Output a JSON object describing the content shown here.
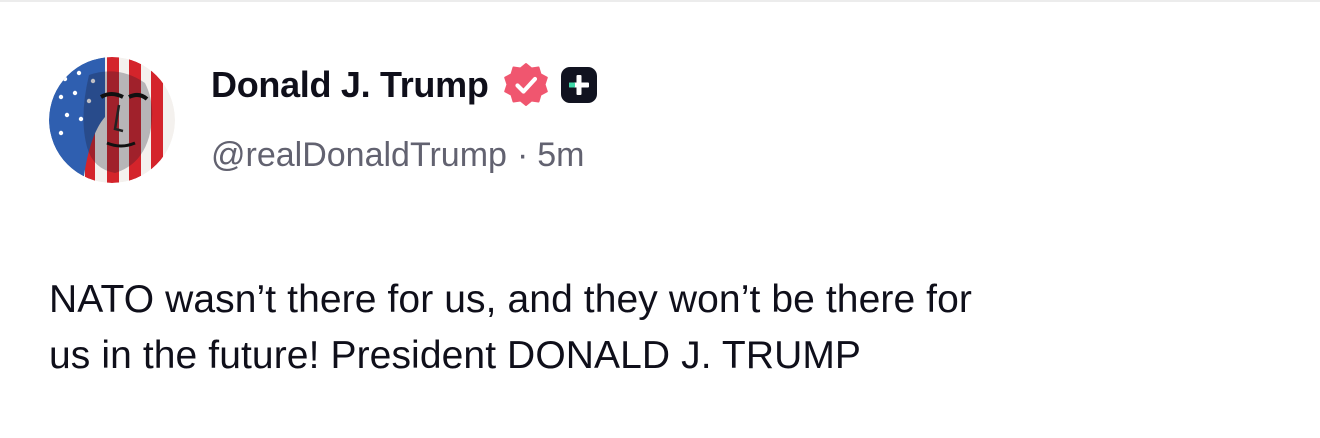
{
  "post": {
    "author": {
      "display_name": "Donald J. Trump",
      "handle": "@realDonaldTrump",
      "verified_icon": "verified-badge-icon",
      "badge_icon": "plus-badge-icon"
    },
    "separator": "·",
    "time": "5m",
    "body_lines": [
      "NATO wasn’t there for us, and they won’t be there for",
      "us in the future! President DONALD J. TRUMP"
    ]
  },
  "colors": {
    "verified_badge": "#f0566f",
    "plus_badge": "#111320",
    "plus_accent": "#3fd9a8",
    "meta_text": "#626270",
    "body_text": "#0f0f1a"
  }
}
